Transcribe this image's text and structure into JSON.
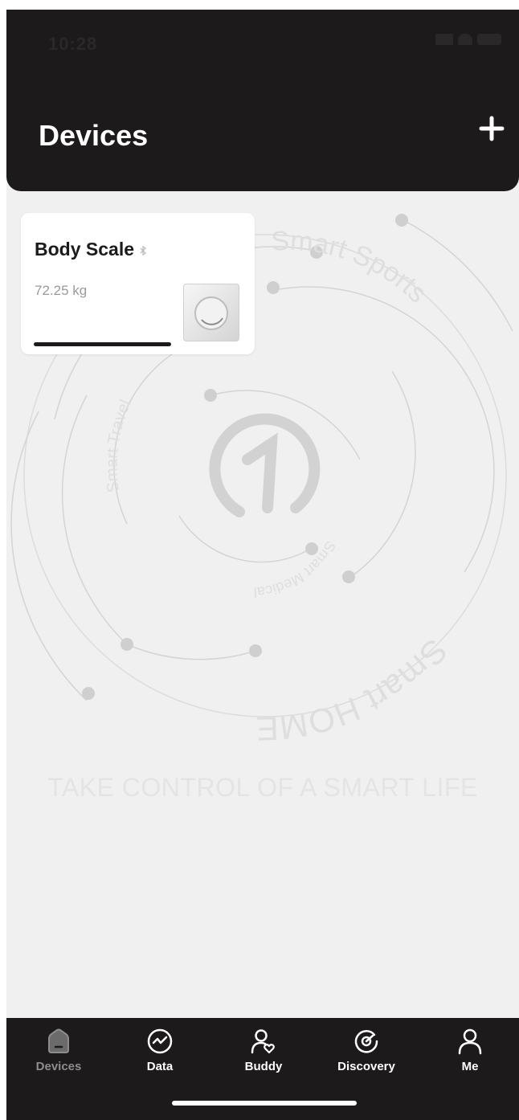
{
  "status_bar": {
    "time": "10:28"
  },
  "header": {
    "title": "Devices",
    "add_icon": "plus-icon"
  },
  "background": {
    "labels": [
      "Smart Sports",
      "Smart Travel",
      "Smart Medical",
      "Smart HOME"
    ],
    "tagline": "TAKE CONTROL OF A SMART LIFE",
    "logo_icon": "brand-logo-icon"
  },
  "device_card": {
    "name": "Body Scale",
    "status_icon": "bluetooth-icon",
    "value": "72.25 kg",
    "thumbnail_icon": "scale-icon"
  },
  "tabbar": {
    "tabs": [
      {
        "label": "Devices",
        "icon": "home-icon",
        "active": true
      },
      {
        "label": "Data",
        "icon": "chart-line-icon",
        "active": false
      },
      {
        "label": "Buddy",
        "icon": "buddy-heart-icon",
        "active": false
      },
      {
        "label": "Discovery",
        "icon": "compass-icon",
        "active": false
      },
      {
        "label": "Me",
        "icon": "person-icon",
        "active": false
      }
    ]
  },
  "colors": {
    "header_bg": "#1c1a1b",
    "page_bg": "#f0f0f0",
    "active_tab": "#8d8d8d",
    "inactive_tab": "#ffffff"
  }
}
